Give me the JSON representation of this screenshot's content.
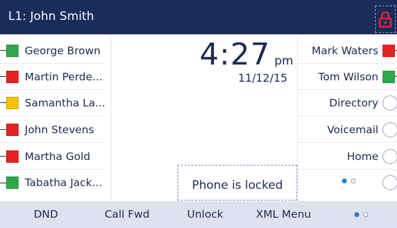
{
  "header": {
    "line_label": "L1: John Smith",
    "lock_icon": "lock-icon",
    "lock_color": "#e8252a"
  },
  "clock": {
    "time": "4:27",
    "ampm": "pm",
    "date": "11/12/15"
  },
  "status_colors": {
    "green": "#2ea84a",
    "red": "#e52320",
    "yellow": "#f5c400"
  },
  "left_keys": [
    {
      "label": "George Brown",
      "status": "green"
    },
    {
      "label": "Martin Perde...",
      "status": "red"
    },
    {
      "label": "Samantha La...",
      "status": "yellow"
    },
    {
      "label": "John Stevens",
      "status": "red"
    },
    {
      "label": "Martha Gold",
      "status": "red"
    },
    {
      "label": "Tabatha Jack...",
      "status": "green"
    }
  ],
  "right_keys": [
    {
      "label": "Mark Waters",
      "status": "red"
    },
    {
      "label": "Tom Wilson",
      "status": "green"
    },
    {
      "label": "Directory"
    },
    {
      "label": "Voicemail"
    },
    {
      "label": "Home"
    }
  ],
  "lock_message": "Phone is locked",
  "softkeys": [
    "DND",
    "Call Fwd",
    "Unlock",
    "XML Menu"
  ]
}
